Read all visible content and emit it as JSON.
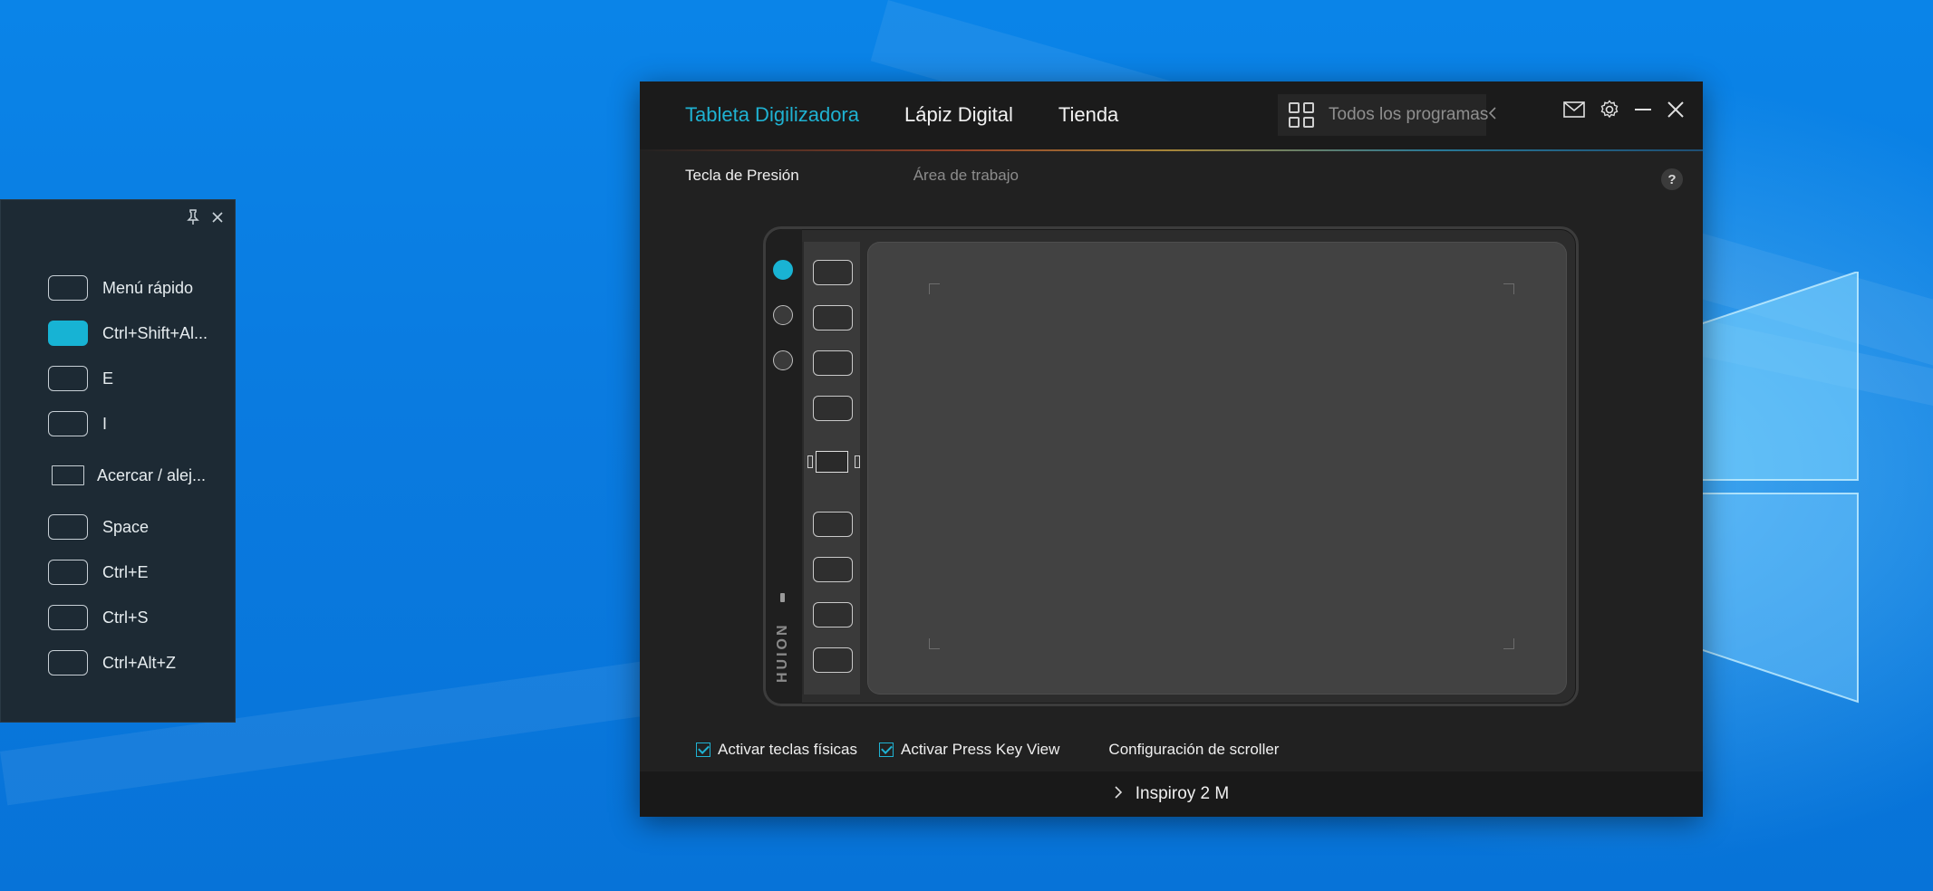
{
  "press_key_view": {
    "pin_icon": "pin-icon",
    "close_icon": "close-icon",
    "items": [
      {
        "label": "Menú rápido",
        "active": false
      },
      {
        "label": "Ctrl+Shift+Al...",
        "active": true
      },
      {
        "label": "E",
        "active": false
      },
      {
        "label": "I",
        "active": false
      },
      {
        "label": "Acercar / alej...",
        "active": false,
        "dial": true
      },
      {
        "label": "Space",
        "active": false
      },
      {
        "label": "Ctrl+E",
        "active": false
      },
      {
        "label": "Ctrl+S",
        "active": false
      },
      {
        "label": "Ctrl+Alt+Z",
        "active": false
      }
    ]
  },
  "app": {
    "tabs": [
      {
        "label": "Tableta Digilizadora",
        "active": true
      },
      {
        "label": "Lápiz Digital",
        "active": false
      },
      {
        "label": "Tienda",
        "active": false
      }
    ],
    "programs": {
      "label": "Todos los programas"
    },
    "subtabs": [
      {
        "label": "Tecla de Presión",
        "active": true
      },
      {
        "label": "Área de trabajo",
        "active": false
      }
    ],
    "help": "?",
    "brand": "HUION",
    "options": {
      "physical_keys": "Activar teclas físicas",
      "press_key_view": "Activar Press Key View",
      "scroller": "Configuración de scroller"
    },
    "device": "Inspiroy 2 M"
  },
  "colors": {
    "accent": "#1fb2d2",
    "window_bg": "#212121",
    "panel_bg": "#1d2a34"
  }
}
